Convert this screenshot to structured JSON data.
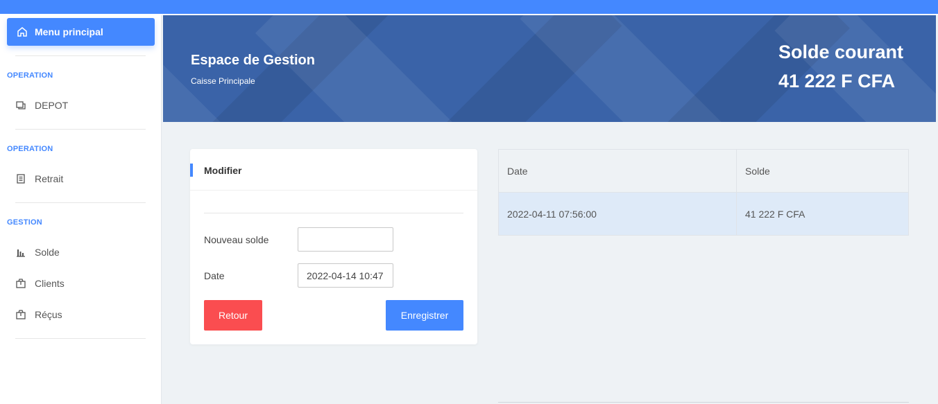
{
  "sidebar": {
    "menu_main": "Menu principal",
    "sections": [
      {
        "title": "OPERATION",
        "items": [
          {
            "label": "DEPOT",
            "icon": "copy-icon"
          }
        ]
      },
      {
        "title": "OPERATION",
        "items": [
          {
            "label": "Retrait",
            "icon": "document-icon"
          }
        ]
      },
      {
        "title": "GESTION",
        "items": [
          {
            "label": "Solde",
            "icon": "bar-chart-icon"
          },
          {
            "label": "Clients",
            "icon": "package-icon"
          },
          {
            "label": "Réçus",
            "icon": "package-icon"
          }
        ]
      }
    ]
  },
  "banner": {
    "title": "Espace de Gestion",
    "subtitle": "Caisse Principale",
    "balance_label": "Solde courant",
    "balance_value": "41 222 F CFA"
  },
  "form": {
    "title": "Modifier",
    "new_balance_label": "Nouveau solde",
    "new_balance_value": "",
    "date_label": "Date",
    "date_value": "2022-04-14 10:47",
    "back_button": "Retour",
    "save_button": "Enregistrer"
  },
  "table": {
    "headers": [
      "Date",
      "Solde"
    ],
    "rows": [
      [
        "2022-04-11 07:56:00",
        "41 222 F CFA"
      ]
    ]
  },
  "colors": {
    "accent": "#4488ff",
    "banner": "#3a63a8",
    "danger": "#fa4d50"
  }
}
